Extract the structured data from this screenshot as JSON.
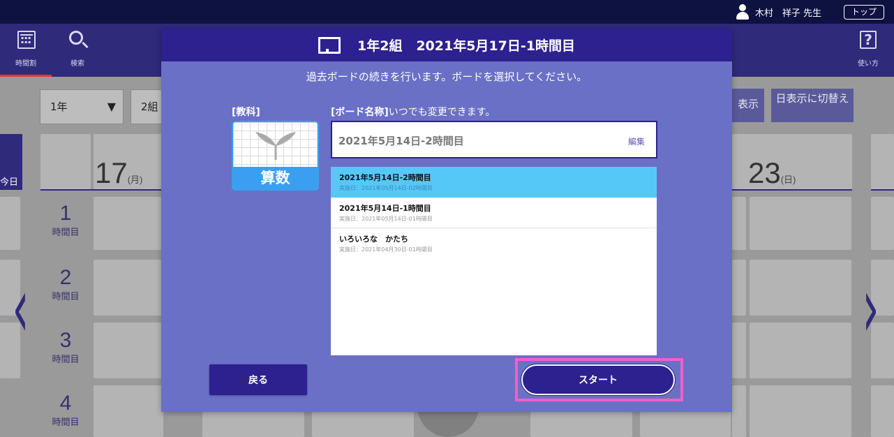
{
  "header": {
    "user_name": "木村　祥子 先生",
    "top_button": "トップ"
  },
  "nav": {
    "timetable": "時間割",
    "search": "検索",
    "help": "使い方"
  },
  "background": {
    "grade_select": "1年",
    "class_select": "2組",
    "week_display_btn": "表示",
    "day_display_btn": "日表示に切替え",
    "today_label": "今日",
    "day_first": "17",
    "day_first_weekday": "(月)",
    "day_last": "23",
    "day_last_weekday": "(日)",
    "periods": [
      {
        "n": "1",
        "t": "時間目"
      },
      {
        "n": "2",
        "t": "時間目"
      },
      {
        "n": "3",
        "t": "時間目"
      },
      {
        "n": "4",
        "t": "時間目"
      }
    ]
  },
  "modal": {
    "title_class": "1年2組",
    "title_date": "2021年5月17日-1時間目",
    "subtitle": "過去ボードの続きを行います。ボードを選択してください。",
    "subject_label": "[教科]",
    "subject_name": "算数",
    "board_label_bold": "[ボード名称]",
    "board_label_rest": "いつでも変更できます。",
    "board_name_value": "2021年5月14日-2時間目",
    "edit_label": "編集",
    "boards": [
      {
        "name": "2021年5月14日-2時間目",
        "date": "実施日：2021年05月14日-02時間目",
        "selected": true
      },
      {
        "name": "2021年5月14日-1時間目",
        "date": "実施日：2021年05月14日-01時間目",
        "selected": false
      },
      {
        "name": "いろいろな　かたち",
        "date": "実施日：2021年04月30日-01時間目",
        "selected": false
      }
    ],
    "back_button": "戻る",
    "start_button": "スタート"
  },
  "colors": {
    "header_bg": "#0e1240",
    "nav_bg": "#2f2a7a",
    "modal_bg": "#6a70c6",
    "modal_header": "#2d208f",
    "selected_row": "#56c8f8",
    "subject_blue": "#3a9ff0",
    "highlight": "#f060c8"
  }
}
